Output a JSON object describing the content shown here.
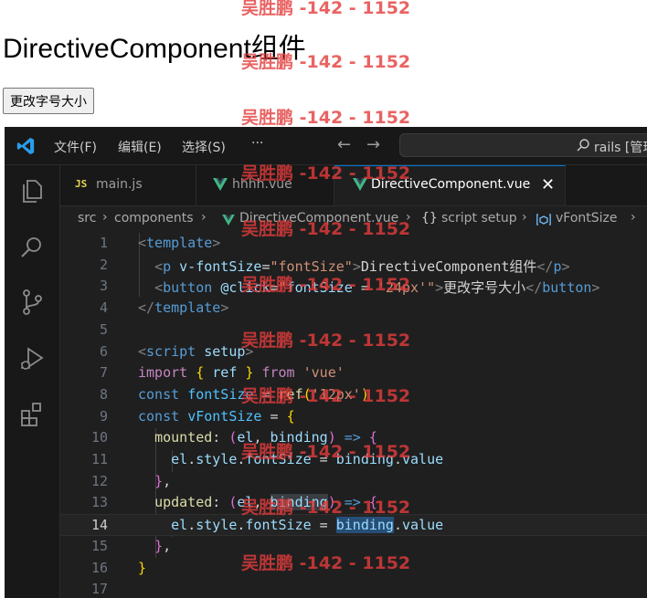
{
  "page": {
    "heading": "DirectiveComponent组件",
    "button_label": "更改字号大小"
  },
  "titlebar": {
    "menu": [
      "文件(F)",
      "编辑(E)",
      "选择(S)",
      "···"
    ],
    "command_center_text": "rails [管理"
  },
  "tabs": [
    {
      "label": "main.js",
      "icon": "js-file-icon"
    },
    {
      "label": "hhhh.vue",
      "icon": "vue-file-icon"
    },
    {
      "label": "DirectiveComponent.vue",
      "icon": "vue-file-icon",
      "active": true,
      "close": "✕"
    }
  ],
  "breadcrumb": [
    "src",
    "components",
    "DirectiveComponent.vue",
    "script setup",
    "vFontSize"
  ],
  "editor": {
    "line_numbers": [
      "1",
      "2",
      "3",
      "4",
      "5",
      "6",
      "7",
      "8",
      "9",
      "10",
      "11",
      "12",
      "13",
      "14",
      "15",
      "16",
      "17"
    ],
    "current_line": "14",
    "code": {
      "l1": {
        "open": "<",
        "tag": "template",
        "close": ">"
      },
      "l2": {
        "lt": "<",
        "tag": "p",
        "attr": "v-fontSize",
        "eq": "=",
        "val": "\"fontSize\"",
        "gt": ">",
        "text": "DirectiveComponent组件",
        "end_open": "</",
        "end_tag": "p",
        "end_close": ">"
      },
      "l3": {
        "lt": "<",
        "tag": "button",
        "attr": "@click",
        "eq": "=",
        "q1": "\"",
        "expr1": "fontSize",
        "expr2": " = ",
        "str": "'24px'",
        "q2": "\"",
        "gt": ">",
        "text": "更改字号大小",
        "end_open": "</",
        "end_tag": "button",
        "end_close": ">"
      },
      "l4": {
        "open": "</",
        "tag": "template",
        "close": ">"
      },
      "l6": {
        "open": "<",
        "tag": "script",
        "attr": "setup",
        "close": ">"
      },
      "l7": {
        "kw": "import",
        "b1": "{",
        "name": "ref",
        "b2": "}",
        "from": "from",
        "str": "'vue'"
      },
      "l8": {
        "kw": "const",
        "name": "fontSize",
        "eq": " = ",
        "fn": "ref",
        "b1": "(",
        "str": "'12px'",
        "b2": ")"
      },
      "l9": {
        "kw": "const",
        "name": "vFontSize",
        "eq": " = ",
        "b1": "{"
      },
      "l10": {
        "key": "mounted",
        "colon": ": ",
        "p1": "(",
        "a1": "el",
        "comma": ", ",
        "a2": "binding",
        "p2": ")",
        "arrow": " => ",
        "b1": "{"
      },
      "l11": {
        "obj": "el",
        "dot1": ".",
        "p1": "style",
        "dot2": ".",
        "p2": "fontSize",
        "eq": " = ",
        "obj2": "binding",
        "dot3": ".",
        "p3": "value"
      },
      "l12": {
        "b": "}",
        "comma": ","
      },
      "l13": {
        "key": "updated",
        "colon": ": ",
        "p1": "(",
        "a1": "el",
        "comma": ", ",
        "a2": "binding",
        "p2": ")",
        "arrow": " => ",
        "b1": "{"
      },
      "l14": {
        "obj": "el",
        "dot1": ".",
        "p1": "style",
        "dot2": ".",
        "p2": "fontSize",
        "eq": " = ",
        "obj2": "binding",
        "dot3": ".",
        "p3": "value"
      },
      "l15": {
        "b": "}",
        "comma": ","
      },
      "l16": {
        "b": "}"
      }
    }
  },
  "watermark": "吴胜鹏 -142 - 1152",
  "colors": {
    "accent": "#0078d4",
    "watermark": "#e43c3c",
    "vue": "#41b883"
  }
}
